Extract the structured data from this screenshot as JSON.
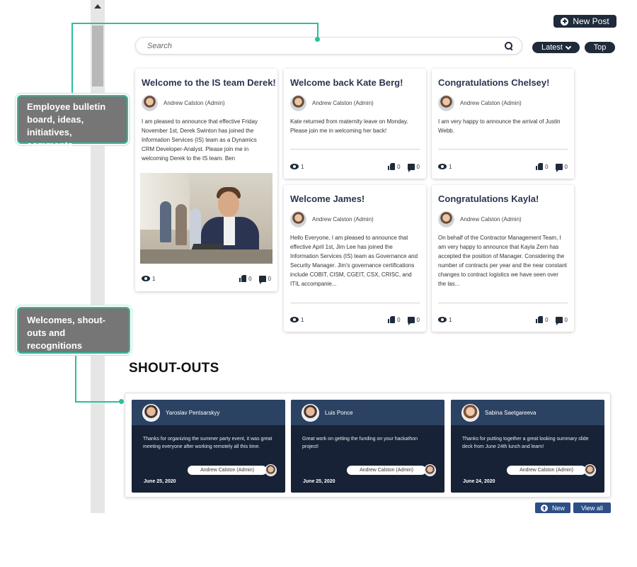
{
  "toolbar": {
    "new_post_label": "New Post",
    "search_placeholder": "Search",
    "sort_latest_label": "Latest",
    "sort_top_label": "Top"
  },
  "posts": [
    {
      "title": "Welcome to the IS team Derek!",
      "author": "Andrew Calston (Admin)",
      "body": "I am pleased to announce that effective Friday November 1st, Derek Swinton has joined the Information Services (IS) team as a Dynamics CRM Developer-Analyst. Please join me in welcoming Derek to the IS team. Ben",
      "views": "1",
      "likes": "0",
      "comments": "0"
    },
    {
      "title": "Welcome back Kate Berg!",
      "author": "Andrew Calston (Admin)",
      "body": "Kate returned from maternity leave on Monday. Please join me in welcoming her back!",
      "views": "1",
      "likes": "0",
      "comments": "0"
    },
    {
      "title": "Congratulations Chelsey!",
      "author": "Andrew Calston (Admin)",
      "body": "I am very happy to announce the arrival of Justin Webb.",
      "views": "1",
      "likes": "0",
      "comments": "0"
    },
    {
      "title": "Welcome James!",
      "author": "Andrew Calston (Admin)",
      "body": "Hello Everyone, I am pleased to announce that effective April 1st, Jim Lee has joined the Information Services (IS) team as Governance and Security Manager. Jim's governance certifications include COBIT, CISM, CGEIT, CSX, CRISC, and ITIL accompanie...",
      "views": "1",
      "likes": "0",
      "comments": "0"
    },
    {
      "title": "Congratulations Kayla!",
      "author": "Andrew Calston (Admin)",
      "body": "On behalf of the Contractor Management Team, I am very happy to announce that Kayla Zern has accepted the position of Manager. Considering the number of contracts per year and the near constant changes to contract logistics we have seen over the las...",
      "views": "1",
      "likes": "0",
      "comments": "0"
    }
  ],
  "callouts": {
    "bulletin": "Employee bulletin board,  ideas, initiatives, comments",
    "welcomes": "Welcomes, shout-outs and recognitions"
  },
  "shoutouts": {
    "title": "SHOUT-OUTS",
    "items": [
      {
        "name": "Yaroslav Pentsarskyy",
        "message": "Thanks for organizing the summer party event, it was great meeting everyone after working remotely all this time.",
        "from": "Andrew Calston (Admin)",
        "date": "June 25, 2020"
      },
      {
        "name": "Luis Ponce",
        "message": "Great work on getting the funding on your hackathon project!",
        "from": "Andrew Calston (Admin)",
        "date": "June 25, 2020"
      },
      {
        "name": "Sabina Saetgareeva",
        "message": "Thanks for putting together a great looking summary slide deck from June 24th lunch and learn!",
        "from": "Andrew Calston (Admin)",
        "date": "June 24, 2020"
      }
    ],
    "new_label": "New",
    "view_all_label": "View all"
  },
  "colors": {
    "accent_teal": "#2bbf9b",
    "navy": "#1f2a3a",
    "shout_bg": "#172236",
    "button_blue": "#2d4f86"
  }
}
